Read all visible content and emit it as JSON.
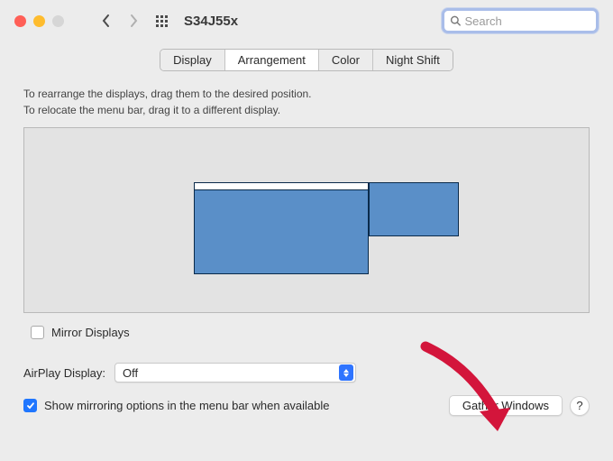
{
  "window": {
    "title": "S34J55x"
  },
  "search": {
    "placeholder": "Search",
    "value": ""
  },
  "tabs": {
    "display": "Display",
    "arrangement": "Arrangement",
    "color": "Color",
    "night_shift": "Night Shift"
  },
  "hint": {
    "line1": "To rearrange the displays, drag them to the desired position.",
    "line2": "To relocate the menu bar, drag it to a different display."
  },
  "mirror": {
    "label": "Mirror Displays",
    "checked": false
  },
  "airplay": {
    "label": "AirPlay Display:",
    "value": "Off"
  },
  "show_mirroring": {
    "label": "Show mirroring options in the menu bar when available",
    "checked": true
  },
  "buttons": {
    "gather": "Gather Windows",
    "help": "?"
  }
}
